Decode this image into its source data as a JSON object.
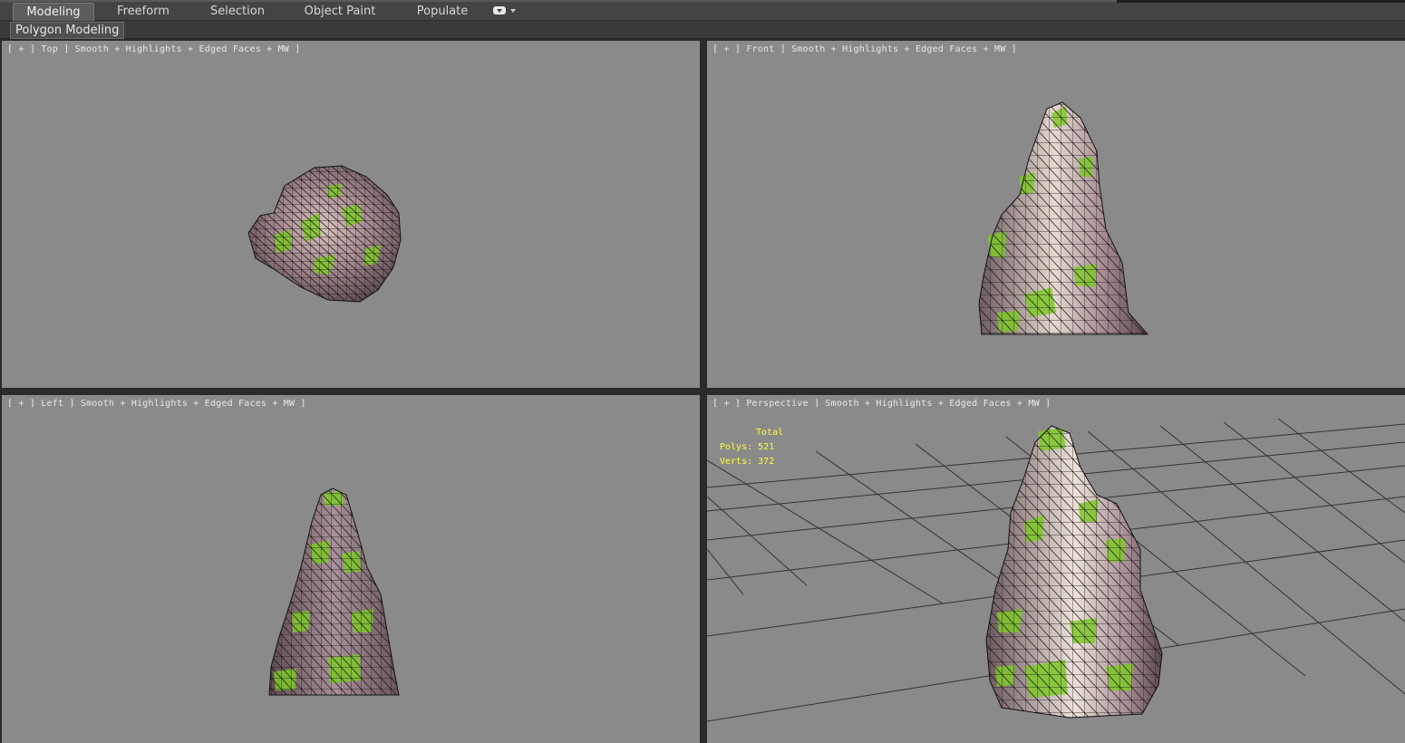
{
  "ribbon": {
    "tabs": [
      {
        "label": "Modeling",
        "active": true
      },
      {
        "label": "Freeform"
      },
      {
        "label": "Selection"
      },
      {
        "label": "Object Paint"
      },
      {
        "label": "Populate"
      }
    ],
    "panel_label": "Polygon Modeling"
  },
  "viewports": {
    "top": {
      "label": "[ + ] Top ] Smooth + Highlights + Edged Faces + MW ]"
    },
    "front": {
      "label": "[ + ] Front ] Smooth + Highlights + Edged Faces + MW ]"
    },
    "left": {
      "label": "[ + ] Left ] Smooth + Highlights + Edged Faces + MW ]"
    },
    "perspective": {
      "label": "[ + ] Perspective ] Smooth + Highlights + Edged Faces + MW ]",
      "stats": {
        "header": "Total",
        "polys_label": "Polys:",
        "polys_value": "521",
        "verts_label": "Verts:",
        "verts_value": "372"
      }
    }
  },
  "colors": {
    "viewport_bg": "#8a8a8a",
    "stats_text": "#ffff3a",
    "rock_base": "#9c7f86",
    "moss": "#7ec82a"
  }
}
